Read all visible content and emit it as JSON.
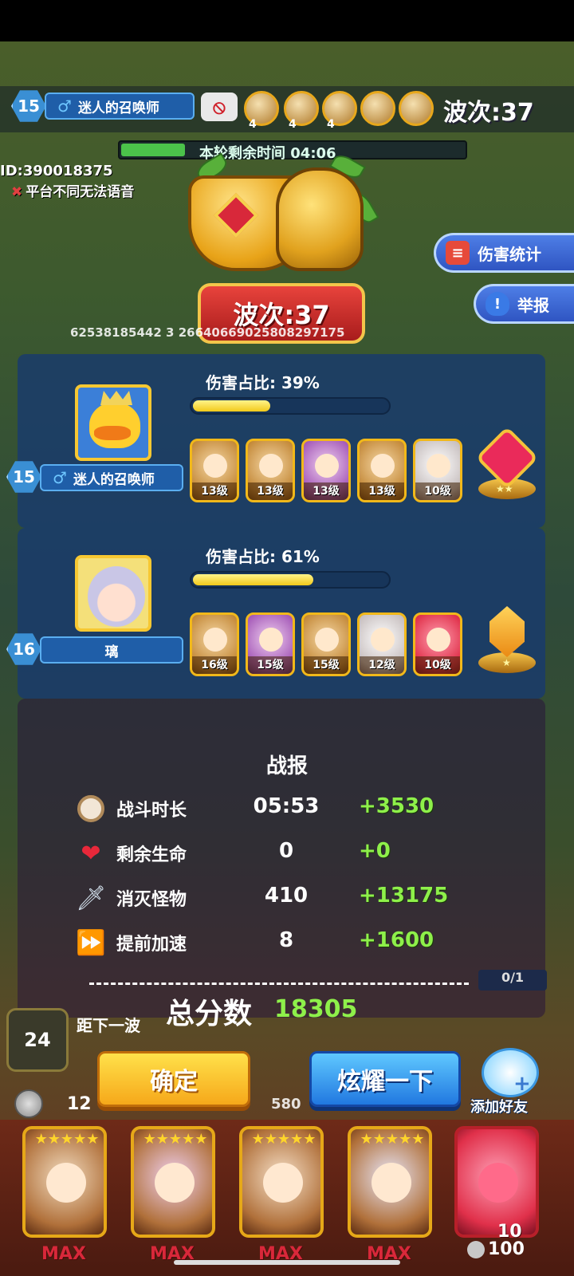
{
  "top": {
    "player_level": "15",
    "player_name": "迷人的召唤师",
    "hero_counts": [
      "4",
      "4",
      "4"
    ],
    "wave": "波次:37",
    "timer_text": "本轮剩余时间 04:06",
    "id_text": "ID:390018375",
    "voice_notice": "平台不同无法语音"
  },
  "side": {
    "damage_stats": "伤害统计",
    "report": "举报"
  },
  "trophy": {
    "wave": "波次:37"
  },
  "background": {
    "numbers_row": "62538185442 3   26640669025808297175"
  },
  "players": [
    {
      "level": "15",
      "name": "迷人的召唤师",
      "damage_label": "伤害占比: 39%",
      "damage_ratio": 0.39,
      "heroes": [
        {
          "level": "13级",
          "theme": "gold"
        },
        {
          "level": "13级",
          "theme": "gold"
        },
        {
          "level": "13级",
          "theme": "purple"
        },
        {
          "level": "13级",
          "theme": "gold"
        },
        {
          "level": "10级",
          "theme": "white"
        }
      ]
    },
    {
      "level": "16",
      "name": "璃",
      "damage_label": "伤害占比: 61%",
      "damage_ratio": 0.61,
      "heroes": [
        {
          "level": "16级",
          "theme": "gold"
        },
        {
          "level": "15级",
          "theme": "purple"
        },
        {
          "level": "15级",
          "theme": "gold"
        },
        {
          "level": "12级",
          "theme": "white"
        },
        {
          "level": "10级",
          "theme": "red"
        }
      ]
    }
  ],
  "report": {
    "title": "战报",
    "rows": [
      {
        "icon": "clock-icon",
        "label": "战斗时长",
        "value": "05:53",
        "bonus": "+3530"
      },
      {
        "icon": "heart-icon",
        "label": "剩余生命",
        "value": "0",
        "bonus": "+0"
      },
      {
        "icon": "sword-icon",
        "label": "消灭怪物",
        "value": "410",
        "bonus": "+13175"
      },
      {
        "icon": "fast-forward-icon",
        "label": "提前加速",
        "value": "8",
        "bonus": "+1600"
      }
    ],
    "total_label": "总分数",
    "total_value": "18305"
  },
  "behind": {
    "wave_count": "24",
    "next_wave": "距下一波",
    "ratio": "0/1",
    "gold": "12",
    "coin_value": "580"
  },
  "buttons": {
    "confirm": "确定",
    "show_off": "炫耀一下",
    "add_friend": "添加好友"
  },
  "bottom": {
    "cards": [
      {
        "label": "MAX"
      },
      {
        "label": "MAX"
      },
      {
        "label": "MAX"
      },
      {
        "label": "MAX"
      }
    ],
    "last_card_level": "10",
    "coins": "100"
  },
  "colors": {
    "bonus_green": "#8ef04a",
    "confirm_yellow": "#f6a81a",
    "show_blue": "#2178e0",
    "panel_blue": "#183a6e"
  }
}
